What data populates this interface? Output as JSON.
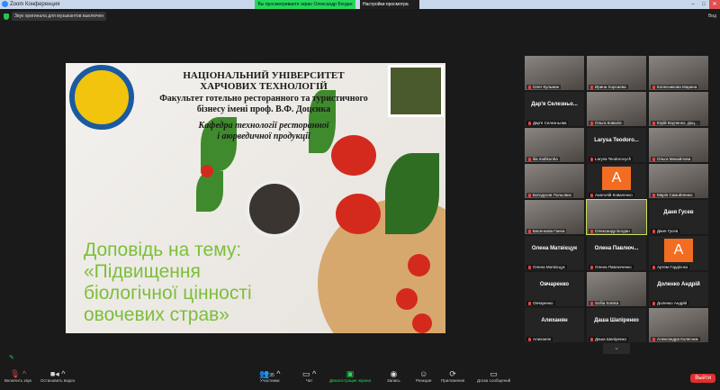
{
  "window": {
    "title": "Zoom Конференция",
    "viewing_banner": "Вы просматриваете экран Олександр Богдан",
    "view_options": "Настройки просмотра",
    "min": "–",
    "max": "□",
    "close": "✕"
  },
  "notice": "Звук оригинала для музыкантов выключен",
  "view_button": "Вид",
  "slide": {
    "university_line1": "НАЦІОНАЛЬНИЙ УНІВЕРСИТЕТ",
    "university_line2": "ХАРЧОВИХ ТЕХНОЛОГІЙ",
    "faculty_line1": "Факультет готельно ресторанного та туристичного",
    "faculty_line2": "бізнесу імені проф. В.Ф. Доцєнка",
    "department_line1": "Кафедра технології ресторанної",
    "department_line2": "і аюрведичної продукції",
    "title_line1": "Доповідь на тему:",
    "title_line2": "«Підвищення",
    "title_line3": "біологічної цінності",
    "title_line4": "овочевих страв»"
  },
  "participants": [
    {
      "type": "video",
      "name": "Олег Кульман"
    },
    {
      "type": "video",
      "name": "Ирина Хорсаевa"
    },
    {
      "type": "video",
      "name": "Колесникова Марина"
    },
    {
      "type": "name",
      "big": "Дар'я Селезньо...",
      "name": "Дар'я Селезньова"
    },
    {
      "type": "video",
      "name": "Ольга Ковалів"
    },
    {
      "type": "video",
      "name": "Юрій Кедченко, Доц..."
    },
    {
      "type": "video",
      "name": "ilia mahkunba"
    },
    {
      "type": "name",
      "big": "Larysa Teodoro...",
      "name": "Larysa Teodorovych"
    },
    {
      "type": "video",
      "name": "Ольга Михайлова"
    },
    {
      "type": "video",
      "name": "Богодухов Польових"
    },
    {
      "type": "avatar",
      "letter": "A",
      "name": "Анатолій Коваленко"
    },
    {
      "type": "video",
      "name": "Марія Самойленко"
    },
    {
      "type": "video",
      "name": "Басенкова Ганна"
    },
    {
      "type": "video",
      "active": true,
      "name": "Олександр Богдан"
    },
    {
      "type": "name",
      "big": "Даня Гусев",
      "name": "Даня Гусев"
    },
    {
      "type": "name",
      "big": "Олена Матвієцук",
      "name": "Олена Матвієцук"
    },
    {
      "type": "name",
      "big": "Олена Павлюч...",
      "name": "Олена Павлюченко"
    },
    {
      "type": "avatar",
      "letter": "A",
      "name": "Артем Гордієнко"
    },
    {
      "type": "name",
      "big": "Овчаренко",
      "name": "Овчаренко"
    },
    {
      "type": "video",
      "name": "Sofiia Sotska"
    },
    {
      "type": "name",
      "big": "Доленко Андрій",
      "name": "Доленко Андрій"
    },
    {
      "type": "name",
      "big": "Алиханян",
      "name": "Алиханян"
    },
    {
      "type": "name",
      "big": "Даша Шапіренко",
      "name": "Даша Шапіренко"
    },
    {
      "type": "video",
      "name": "Александра Колесник"
    }
  ],
  "more_chevron": "⌄",
  "toolbar": {
    "unmute": "Включить звук",
    "video": "Остановить видео",
    "participants": "Участники",
    "participants_count": "35",
    "chat": "Чат",
    "share": "Демонстрация экрана",
    "record": "Запись",
    "reactions": "Реакции",
    "apps": "Приложения",
    "whiteboard": "Доска сообщений",
    "leave": "Выйти"
  },
  "colors": {
    "share_green": "#23d959",
    "leave_red": "#e0302d",
    "avatar_orange": "#f26d21"
  }
}
